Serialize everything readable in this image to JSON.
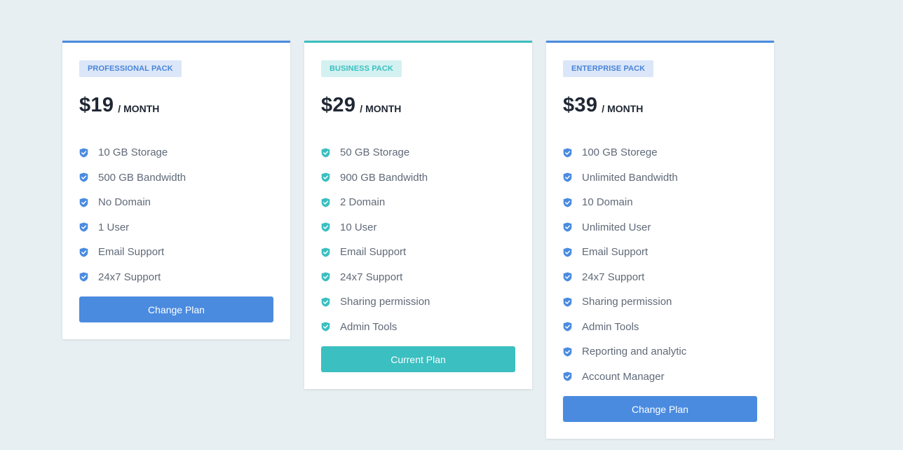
{
  "colors": {
    "background": "#e8eff2",
    "blue_accent": "#4a8be0",
    "teal_accent": "#3bbfc0"
  },
  "plans": [
    {
      "badge": "PROFESSIONAL PACK",
      "price": "$19",
      "period": "/ MONTH",
      "accent": "blue",
      "feature_icon": "shield-check-icon",
      "features": [
        "10 GB Storage",
        "500 GB Bandwidth",
        "No Domain",
        "1 User",
        "Email Support",
        "24x7 Support"
      ],
      "button_label": "Change Plan"
    },
    {
      "badge": "BUSINESS PACK",
      "price": "$29",
      "period": "/ MONTH",
      "accent": "teal",
      "feature_icon": "shield-check-icon",
      "features": [
        "50 GB Storage",
        "900 GB Bandwidth",
        "2 Domain",
        "10 User",
        "Email Support",
        "24x7 Support",
        "Sharing permission",
        "Admin Tools"
      ],
      "button_label": "Current Plan"
    },
    {
      "badge": "ENTERPRISE PACK",
      "price": "$39",
      "period": "/ MONTH",
      "accent": "blue",
      "feature_icon": "shield-check-icon",
      "features": [
        "100 GB Storege",
        "Unlimited Bandwidth",
        "10 Domain",
        "Unlimited User",
        "Email Support",
        "24x7 Support",
        "Sharing permission",
        "Admin Tools",
        "Reporting and analytic",
        "Account Manager"
      ],
      "button_label": "Change Plan"
    }
  ]
}
